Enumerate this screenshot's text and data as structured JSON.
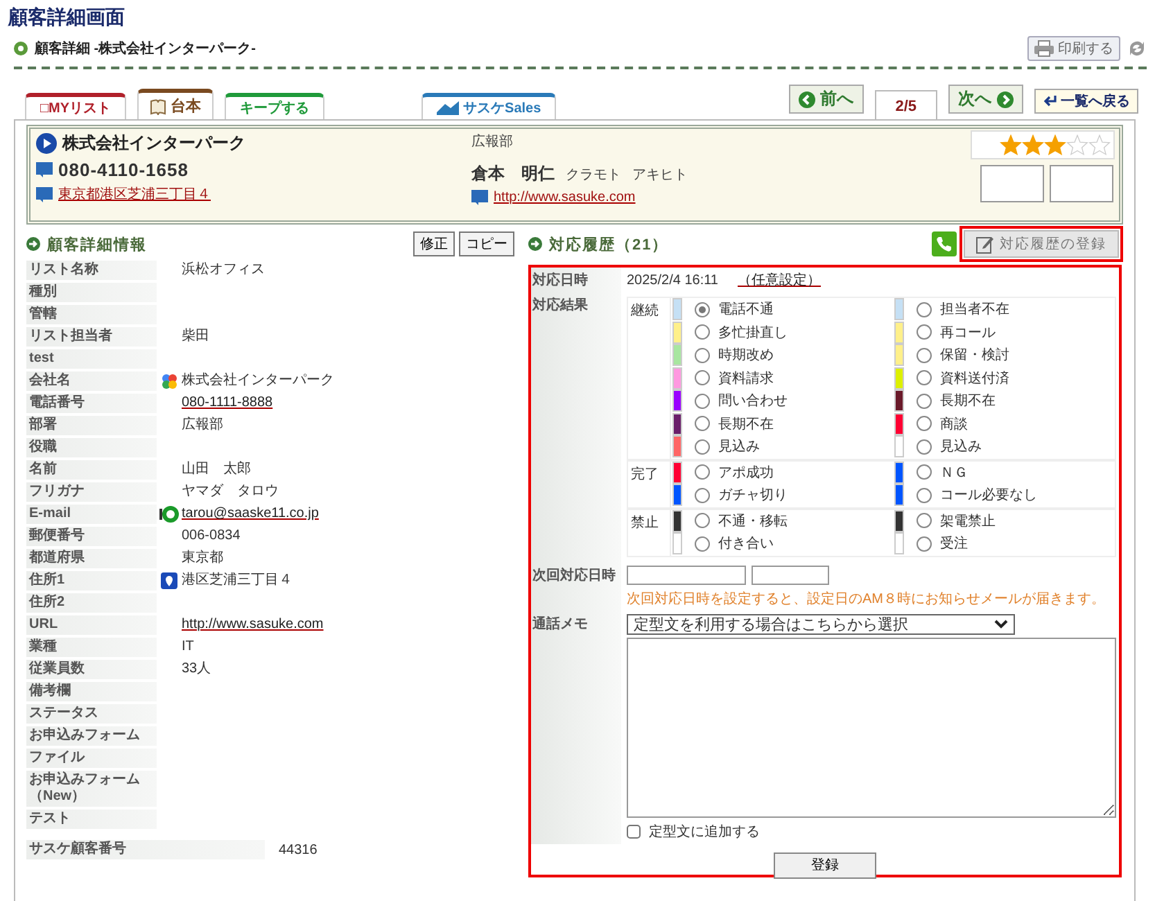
{
  "page_title": "顧客詳細画面",
  "header": {
    "title": "顧客詳細 -株式会社インターパーク-",
    "print_button": "印刷する"
  },
  "tabs": [
    {
      "label": "□MYリスト",
      "kind": "mylist"
    },
    {
      "label": "台本",
      "kind": "script"
    },
    {
      "label": "キープする",
      "kind": "keep"
    },
    {
      "label": "サスケSales",
      "kind": "sales"
    }
  ],
  "pager": {
    "prev": "前へ",
    "current": "2/5",
    "next": "次へ",
    "back": "一覧へ戻る"
  },
  "card": {
    "company": "株式会社インターパーク",
    "department": "広報部",
    "phone": "080-4110-1658",
    "address": "東京都港区芝浦三丁目４",
    "contact_name": "倉本　明仁",
    "kana_last": "クラモト",
    "kana_first": "アキヒト",
    "url": "http://www.sasuke.com",
    "stars": 3
  },
  "detail": {
    "heading": "顧客詳細情報",
    "buttons": [
      "修正",
      "コピー"
    ],
    "rows": [
      {
        "label": "リスト名称",
        "value": "浜松オフィス",
        "kind": "text"
      },
      {
        "label": "種別"
      },
      {
        "label": "管轄"
      },
      {
        "label": "リスト担当者",
        "value": "柴田",
        "kind": "text"
      },
      {
        "label": "test"
      },
      {
        "label": "会社名",
        "value": "株式会社インターパーク",
        "kind": "company"
      },
      {
        "label": "電話番号",
        "value": "080-1111-8888",
        "kind": "link"
      },
      {
        "label": "部署",
        "value": "広報部",
        "kind": "text"
      },
      {
        "label": "役職"
      },
      {
        "label": "名前",
        "value": "山田　太郎",
        "kind": "text"
      },
      {
        "label": "フリガナ",
        "value": "ヤマダ　タロウ",
        "kind": "text"
      },
      {
        "label": "E-mail",
        "value": "tarou@saaske11.co.jp",
        "kind": "email"
      },
      {
        "label": "郵便番号",
        "value": "006-0834",
        "kind": "text"
      },
      {
        "label": "都道府県",
        "value": "東京都",
        "kind": "text"
      },
      {
        "label": "住所1",
        "value": "港区芝浦三丁目４",
        "kind": "address"
      },
      {
        "label": "住所2"
      },
      {
        "label": "URL",
        "value": "http://www.sasuke.com",
        "kind": "link"
      },
      {
        "label": "業種",
        "value": "IT",
        "kind": "text"
      },
      {
        "label": "従業員数",
        "value": "33人",
        "kind": "text"
      },
      {
        "label": "備考欄"
      },
      {
        "label": "ステータス"
      },
      {
        "label": "お申込みフォーム"
      },
      {
        "label": "ファイル"
      },
      {
        "label": "お申込みフォーム（New）"
      },
      {
        "label": "テスト"
      }
    ],
    "customer_number": {
      "label": "サスケ顧客番号",
      "value": "44316"
    }
  },
  "history": {
    "heading": "対応履歴（21）",
    "register_button": "対応履歴の登録",
    "date_label": "対応日時",
    "date_value": "2025/2/4 16:11",
    "date_link": "（任意設定）",
    "result_label": "対応結果",
    "groups": [
      {
        "label": "継続",
        "options": [
          {
            "label": "電話不通",
            "color": "#c5e0f5",
            "selected": true
          },
          {
            "label": "担当者不在",
            "color": "#c5e0f5",
            "selected": false
          },
          {
            "label": "多忙掛直し",
            "color": "#fff08a",
            "selected": false
          },
          {
            "label": "再コール",
            "color": "#fff08a",
            "selected": false
          },
          {
            "label": "時期改め",
            "color": "#a8e6a0",
            "selected": false
          },
          {
            "label": "保留・検討",
            "color": "#fff08a",
            "selected": false
          },
          {
            "label": "資料請求",
            "color": "#ff99e0",
            "selected": false
          },
          {
            "label": "資料送付済",
            "color": "#ddf000",
            "selected": false
          },
          {
            "label": "問い合わせ",
            "color": "#9900ff",
            "selected": false
          },
          {
            "label": "長期不在",
            "color": "#6a1a2a",
            "selected": false
          },
          {
            "label": "長期不在",
            "color": "#6a1e6a",
            "selected": false
          },
          {
            "label": "商談",
            "color": "#ff0033",
            "selected": false
          },
          {
            "label": "見込み",
            "color": "#ff6666",
            "selected": false
          },
          {
            "label": "見込み",
            "color": "#ffffff",
            "selected": false
          }
        ]
      },
      {
        "label": "完了",
        "options": [
          {
            "label": "アポ成功",
            "color": "#ff0033",
            "selected": false
          },
          {
            "label": "ＮＧ",
            "color": "#0055ff",
            "selected": false
          },
          {
            "label": "ガチャ切り",
            "color": "#0055ff",
            "selected": false
          },
          {
            "label": "コール必要なし",
            "color": "#0055ff",
            "selected": false
          }
        ]
      },
      {
        "label": "禁止",
        "options": [
          {
            "label": "不通・移転",
            "color": "#333333",
            "selected": false
          },
          {
            "label": "架電禁止",
            "color": "#333333",
            "selected": false
          },
          {
            "label": "付き合い",
            "color": "#ffffff",
            "selected": false
          },
          {
            "label": "受注",
            "color": "#ffffff",
            "selected": false
          }
        ]
      }
    ],
    "next_label": "次回対応日時",
    "next_hint": "次回対応日時を設定すると、設定日のAM８時にお知らせメールが届きます。",
    "memo_label": "通話メモ",
    "template_select": "定型文を利用する場合はこちらから選択",
    "add_template": {
      "label": "定型文に追加する",
      "checked": false
    },
    "submit": "登録"
  }
}
